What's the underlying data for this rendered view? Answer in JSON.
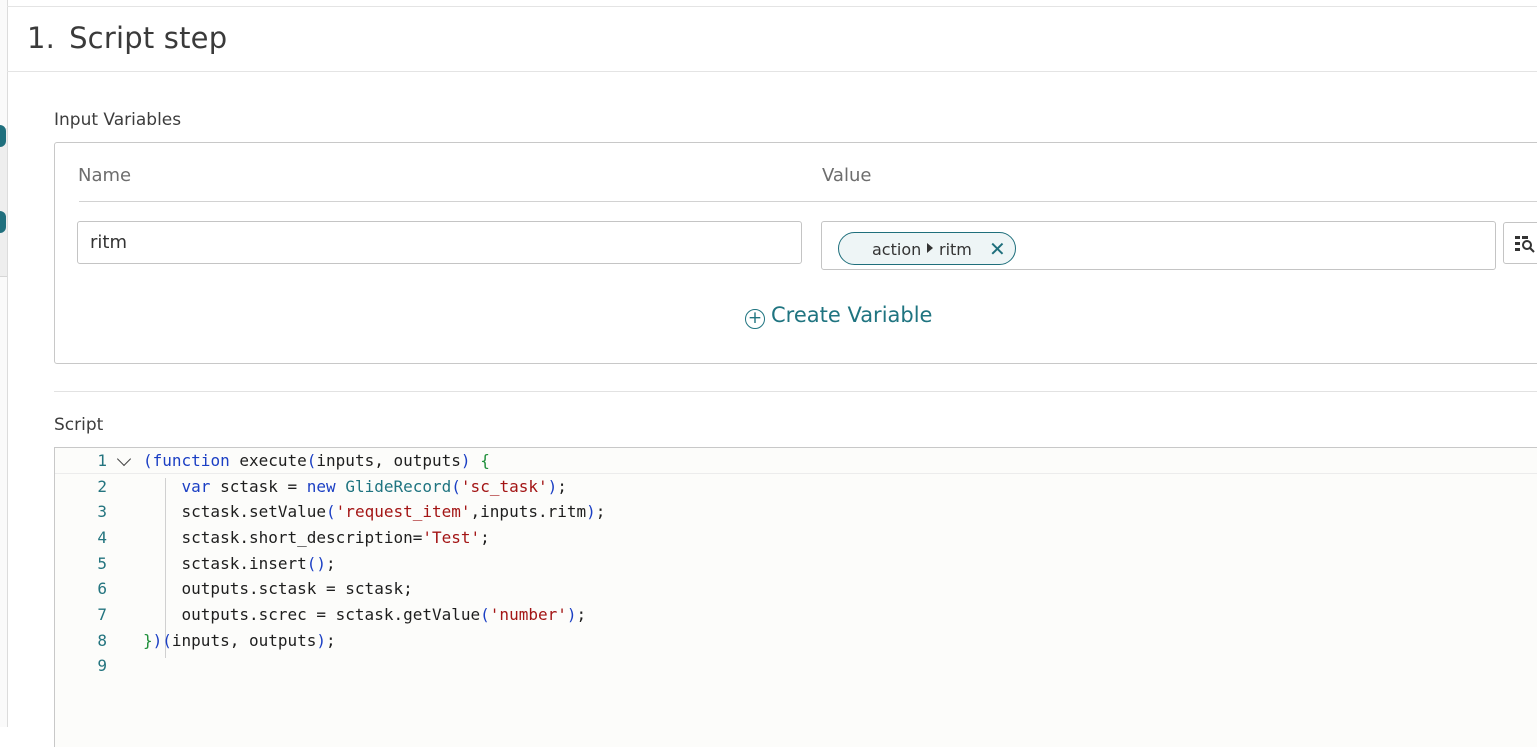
{
  "step": {
    "number": "1.",
    "title": "Script step"
  },
  "input_variables": {
    "label": "Input Variables",
    "columns": {
      "name": "Name",
      "value": "Value"
    },
    "rows": [
      {
        "name": "ritm",
        "value_path": [
          "action",
          "ritm"
        ]
      }
    ],
    "create_label": "Create Variable"
  },
  "script": {
    "label": "Script",
    "lines": [
      {
        "n": "1"
      },
      {
        "n": "2"
      },
      {
        "n": "3"
      },
      {
        "n": "4"
      },
      {
        "n": "5"
      },
      {
        "n": "6"
      },
      {
        "n": "7"
      },
      {
        "n": "8"
      },
      {
        "n": "9"
      }
    ]
  },
  "icons": {
    "pill_close": "close-icon",
    "data_pill_picker": "data-pill-picker-icon",
    "create": "plus-circle-icon",
    "fold": "chevron-down-icon"
  },
  "colors": {
    "accent": "#1f7480",
    "keyword": "#1b3fc4",
    "string": "#a31515"
  }
}
